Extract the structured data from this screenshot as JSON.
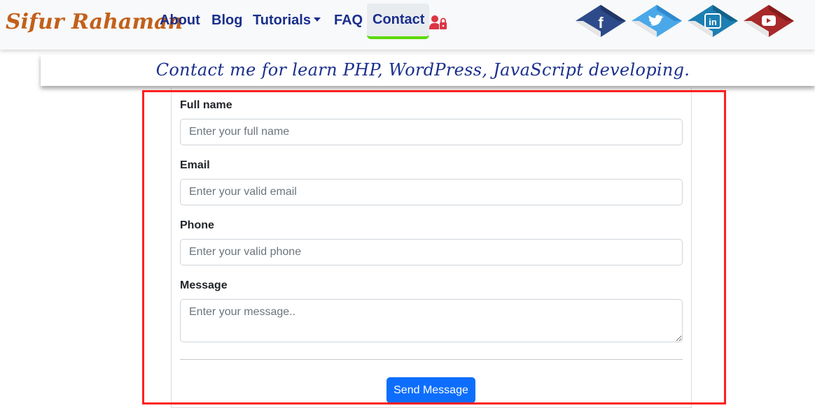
{
  "brand": "Sifur Rahaman",
  "nav": {
    "about": "About",
    "blog": "Blog",
    "tutorials": "Tutorials",
    "faq": "FAQ",
    "contact": "Contact"
  },
  "social_icons": [
    "facebook-icon",
    "twitter-icon",
    "linkedin-icon",
    "youtube-icon"
  ],
  "banner": "Contact me for learn PHP, WordPress, JavaScript developing.",
  "form": {
    "name_label": "Full name",
    "name_placeholder": "Enter your full name",
    "email_label": "Email",
    "email_placeholder": "Enter your valid email",
    "phone_label": "Phone",
    "phone_placeholder": "Enter your valid phone",
    "message_label": "Message",
    "message_placeholder": "Enter your message..",
    "submit_label": "Send Message"
  },
  "colors": {
    "brand": "#c2601a",
    "nav_text": "#1a2f8c",
    "active_underline": "#5ad900",
    "button": "#0d6efd",
    "highlight": "#ff1f1f"
  }
}
